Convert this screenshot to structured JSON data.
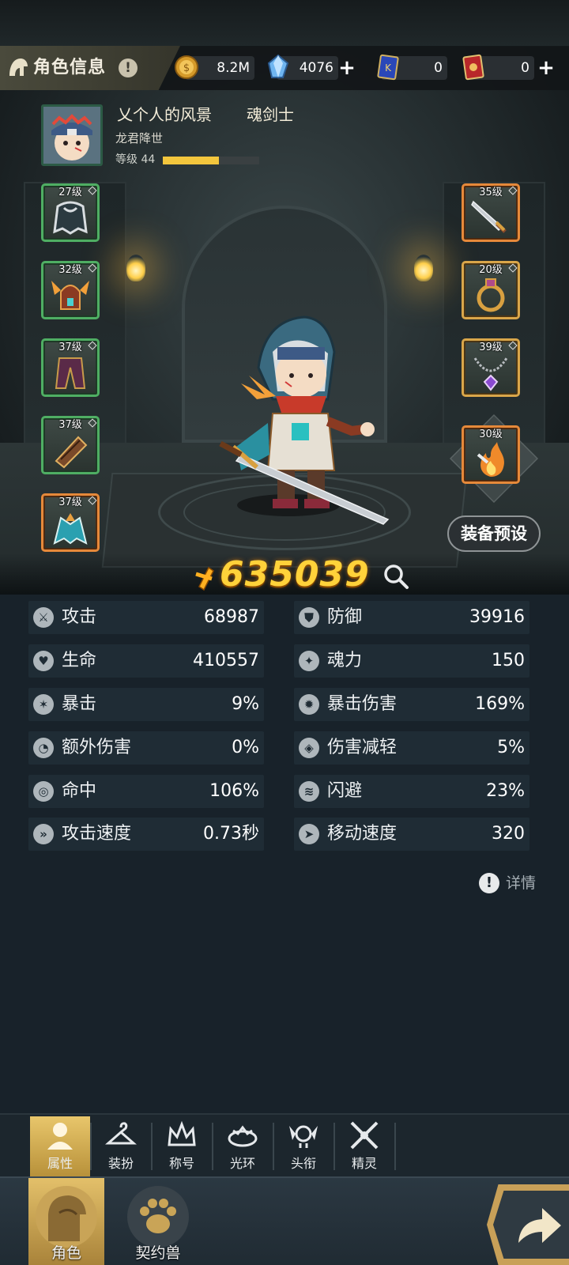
{
  "header": {
    "title": "角色信息",
    "title_icon": "helmet-icon",
    "help_glyph": "!"
  },
  "resources": [
    {
      "name": "gold-coin-icon",
      "value": "8.2M",
      "has_plus": false
    },
    {
      "name": "crystal-icon",
      "value": "4076",
      "has_plus": true
    },
    {
      "name": "blue-ticket-icon",
      "value": "0",
      "has_plus": false
    },
    {
      "name": "red-ticket-icon",
      "value": "0",
      "has_plus": true
    }
  ],
  "player": {
    "name": "乂个人的风景",
    "class": "魂剑士",
    "title": "龙君降世",
    "level_label": "等级 44",
    "level_progress": 0.58
  },
  "equipment": {
    "left": [
      {
        "level": "27级",
        "item": "cloak-icon",
        "rarity": "green"
      },
      {
        "level": "32级",
        "item": "winged-helmet-icon",
        "rarity": "green"
      },
      {
        "level": "37级",
        "item": "pants-icon",
        "rarity": "green"
      },
      {
        "level": "37级",
        "item": "gauntlet-icon",
        "rarity": "green"
      },
      {
        "level": "37级",
        "item": "boots-icon",
        "rarity": "orange"
      }
    ],
    "right": [
      {
        "level": "35级",
        "item": "sword-icon",
        "rarity": "orange"
      },
      {
        "level": "20级",
        "item": "ring-icon",
        "rarity": "gold"
      },
      {
        "level": "39级",
        "item": "necklace-icon",
        "rarity": "gold"
      },
      {
        "level": "30级",
        "item": "fire-skill-icon",
        "rarity": "orange"
      }
    ]
  },
  "preset_button": "装备预设",
  "power": {
    "value": "635039"
  },
  "stats": [
    {
      "label": "攻击",
      "value": "68987",
      "icon": "attack-icon"
    },
    {
      "label": "防御",
      "value": "39916",
      "icon": "defense-icon"
    },
    {
      "label": "生命",
      "value": "410557",
      "icon": "heart-icon"
    },
    {
      "label": "魂力",
      "value": "150",
      "icon": "soul-icon"
    },
    {
      "label": "暴击",
      "value": "9%",
      "icon": "crit-icon"
    },
    {
      "label": "暴击伤害",
      "value": "169%",
      "icon": "crit-damage-icon"
    },
    {
      "label": "额外伤害",
      "value": "0%",
      "icon": "extra-damage-icon"
    },
    {
      "label": "伤害减轻",
      "value": "5%",
      "icon": "damage-reduction-icon"
    },
    {
      "label": "命中",
      "value": "106%",
      "icon": "accuracy-icon"
    },
    {
      "label": "闪避",
      "value": "23%",
      "icon": "dodge-icon"
    },
    {
      "label": "攻击速度",
      "value": "0.73秒",
      "icon": "attack-speed-icon"
    },
    {
      "label": "移动速度",
      "value": "320",
      "icon": "move-speed-icon"
    }
  ],
  "detail_link": "详情",
  "subtabs": [
    {
      "label": "属性",
      "icon": "person-icon",
      "active": true
    },
    {
      "label": "装扮",
      "icon": "hanger-icon",
      "active": false
    },
    {
      "label": "称号",
      "icon": "crown-icon",
      "active": false
    },
    {
      "label": "光环",
      "icon": "halo-icon",
      "active": false
    },
    {
      "label": "头衔",
      "icon": "skull-wings-icon",
      "active": false
    },
    {
      "label": "精灵",
      "icon": "crossed-swords-icon",
      "active": false
    }
  ],
  "bottom_nav": [
    {
      "label": "角色",
      "icon": "character-icon",
      "active": true
    },
    {
      "label": "契约兽",
      "icon": "paw-icon",
      "active": false
    }
  ],
  "colors": {
    "power_gold": "#ffd23a",
    "level_fill": "#f3c63d",
    "green_rarity": "#4fae63",
    "gold_rarity": "#d9a64a",
    "orange_rarity": "#e6893a",
    "active_tab": "#e3c06a"
  }
}
